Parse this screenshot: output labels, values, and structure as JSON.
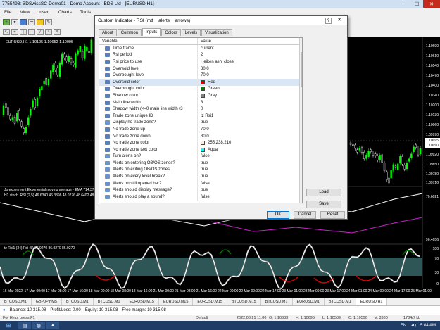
{
  "window": {
    "title": "7755498: BDSwissSC-Demo01 - Demo Account - BDS Ltd - [EURUSD,H1]",
    "menu": [
      "File",
      "View",
      "Insert",
      "Charts",
      "Tools"
    ]
  },
  "chart": {
    "symbol_label": "EURUSD,H1  1.10195 1.10652 1.10095",
    "indicator_label": "Jo experiment Exponential moving average - EMA 714.37",
    "stoch_label": "H1 stoch. RSI (2,5) 46.6340 46.3398 48.0276 48.6402 48.64",
    "rsi_label": "tz Rsi1 (34) Rsi (5) 86.9270 86.9270 86.9270",
    "price_axis": [
      "1.10690",
      "1.10610",
      "1.10540",
      "1.10470",
      "1.10400",
      "1.10340",
      "1.10200",
      "1.10130",
      "1.10060",
      "1.09990",
      "1.09920",
      "1.09850",
      "1.09780",
      "1.09710"
    ],
    "price_tags": [
      "1.10095",
      "1.10090"
    ],
    "stoch_axis": [
      "70.6021"
    ],
    "rsi_axis": [
      "100",
      "70",
      "30",
      "0"
    ],
    "sub_axis": [
      "96.4056"
    ],
    "dates": [
      "16 Mar 2022",
      "17 Mar 00:00",
      "17 Mar 08:00",
      "17 Mar 16:00",
      "18 Mar 00:00",
      "18 Mar 08:00",
      "18 Mar 16:00",
      "21 Mar 00:00",
      "21 Mar 08:00",
      "21 Mar 16:00",
      "22 Mar 00:00",
      "22 Mar 09:00",
      "22 Mar 17:00",
      "23 Mar 01:00",
      "23 Mar 09:00",
      "23 Mar 17:00",
      "24 Mar 01:00",
      "24 Mar 09:00",
      "24 Mar 17:00",
      "25 Mar 01:00"
    ]
  },
  "dialog": {
    "title": "Custom Indicator - RSI (mtf + alerts + arrows)",
    "help": "?",
    "close": "✕",
    "tabs": [
      "About",
      "Common",
      "Inputs",
      "Colors",
      "Levels",
      "Visualization"
    ],
    "active_tab": "Inputs",
    "columns": [
      "Variable",
      "Value"
    ],
    "rows": [
      {
        "variable": "Time frame",
        "value": "current",
        "icon": "param"
      },
      {
        "variable": "Rsi period",
        "value": "2",
        "icon": "param"
      },
      {
        "variable": "Rsi price to use",
        "value": "Heiken ashi close",
        "icon": "param"
      },
      {
        "variable": "Oversold level",
        "value": "30.0",
        "icon": "param"
      },
      {
        "variable": "Overbought level",
        "value": "70.0",
        "icon": "param"
      },
      {
        "variable": "Oversold color",
        "value": "Red",
        "icon": "param",
        "swatch": "#e00000"
      },
      {
        "variable": "Overbought color",
        "value": "Green",
        "icon": "param",
        "swatch": "#008000"
      },
      {
        "variable": "Shadow color",
        "value": "Gray",
        "icon": "param",
        "swatch": "#808080"
      },
      {
        "variable": "Main line width",
        "value": "3",
        "icon": "param"
      },
      {
        "variable": "Shadow width (<=0 main line width+3",
        "value": "0",
        "icon": "param"
      },
      {
        "variable": "Trade zone unique ID",
        "value": "tz Rsi1",
        "icon": "param"
      },
      {
        "variable": "Display no trade zone?",
        "value": "true",
        "icon": "flag"
      },
      {
        "variable": "No trade zone up",
        "value": "70.0",
        "icon": "param"
      },
      {
        "variable": "No trade zone down",
        "value": "30.0",
        "icon": "param"
      },
      {
        "variable": "No trade zone color",
        "value": "255,238,210",
        "icon": "param",
        "swatch": "#ffeed2"
      },
      {
        "variable": "No trade zone text color",
        "value": "Aqua",
        "icon": "param",
        "swatch": "#00ffff"
      },
      {
        "variable": "Turn alerts on?",
        "value": "false",
        "icon": "flag"
      },
      {
        "variable": "Alerts on entering OB/OS zones?",
        "value": "true",
        "icon": "flag"
      },
      {
        "variable": "Alerts on exiting OB/OS zones",
        "value": "true",
        "icon": "flag"
      },
      {
        "variable": "Alerts on every level break?",
        "value": "true",
        "icon": "flag"
      },
      {
        "variable": "Alerts on still opened bar?",
        "value": "false",
        "icon": "flag"
      },
      {
        "variable": "Alerts should display message?",
        "value": "true",
        "icon": "flag"
      },
      {
        "variable": "Alerts should play a sound?",
        "value": "false",
        "icon": "flag"
      }
    ],
    "buttons": {
      "load": "Load",
      "save": "Save",
      "ok": "OK",
      "cancel": "Cancel",
      "reset": "Reset"
    }
  },
  "symbol_tabs": [
    "BTCUSD,M1",
    "GBPJPY,M5",
    "BTCUSD,M1",
    "BTCUSD,M1",
    "EURUSD,M15",
    "EURUSD,M15",
    "EURUSD,M15",
    "BTCUSD,M15",
    "BTCUSD,M1",
    "EURUSD,M1",
    "BTCUSD,M1",
    "EURUSD,H1"
  ],
  "balance": {
    "balance": "Balance: 10 315.08",
    "profit": "Profit/Loss: 0.00",
    "equity": "Equity: 10 315.08",
    "free_margin": "Free margin: 10 315.08"
  },
  "status": {
    "help": "For Help, press F1",
    "profile": "Default",
    "datetime": "2022.03.21 11:00",
    "open": "O: 1.10633",
    "high": "H: 1.10695",
    "low": "L: 1.10589",
    "close": "C: 1.10590",
    "volume": "V: 3930",
    "traffic": "1734/7 kb"
  },
  "taskbar": {
    "lang": "EN",
    "time": "5:04 AM"
  },
  "colors": {
    "oversold": "#e00000",
    "overbought": "#008000",
    "stoch_line": "#cc22cc",
    "no_trade_zone": "#2f5656",
    "candle_up": "#00ff00",
    "candle_down": "#ffffff"
  }
}
